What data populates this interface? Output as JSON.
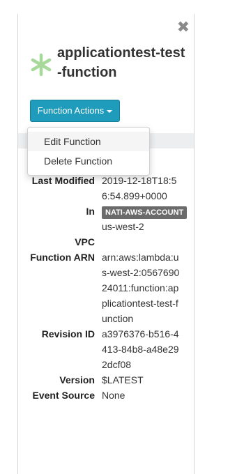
{
  "title": "applicationtest-test-function",
  "actions": {
    "button_label": "Function Actions",
    "menu": [
      "Edit Function",
      "Delete Function"
    ]
  },
  "details": {
    "last_modified_label": "Last Modified",
    "last_modified_value": "2019-12-18T18:56:54.899+0000",
    "in_label": "In",
    "in_account": "NATI-AWS-ACCOUNT",
    "in_region": "us-west-2",
    "vpc_label": "VPC",
    "vpc_value": "",
    "arn_label": "Function ARN",
    "arn_value": "arn:aws:lambda:us-west-2:056769024011:function:applicationtest-test-function",
    "revision_label": "Revision ID",
    "revision_value": "a3976376-b516-4413-84b8-a48e292dcf08",
    "version_label": "Version",
    "version_value": "$LATEST",
    "event_label": "Event Source",
    "event_value": "None"
  },
  "colors": {
    "button": "#1f9cbc",
    "icon": "#a7d99a",
    "badge": "#6b6b6b"
  },
  "icons": {
    "close": "close-icon",
    "service": "asterisk-lambda-icon"
  }
}
